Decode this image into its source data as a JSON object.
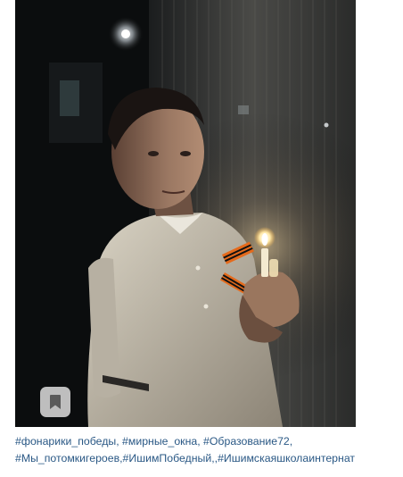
{
  "post": {
    "photo": {
      "alt_icon": "photo-placeholder",
      "save_icon": "bookmark-icon"
    },
    "caption_lines": [
      "#фонарики_победы, #мирные_окна, #Образование72,",
      "#Мы_потомкигероев,#ИшимПобедный,,#Ишимскаяшколаинтернат"
    ],
    "colors": {
      "hashtag": "#2a5885",
      "save_button_bg": "#d7d7d7",
      "bookmark_icon": "#5a5a5a"
    }
  }
}
